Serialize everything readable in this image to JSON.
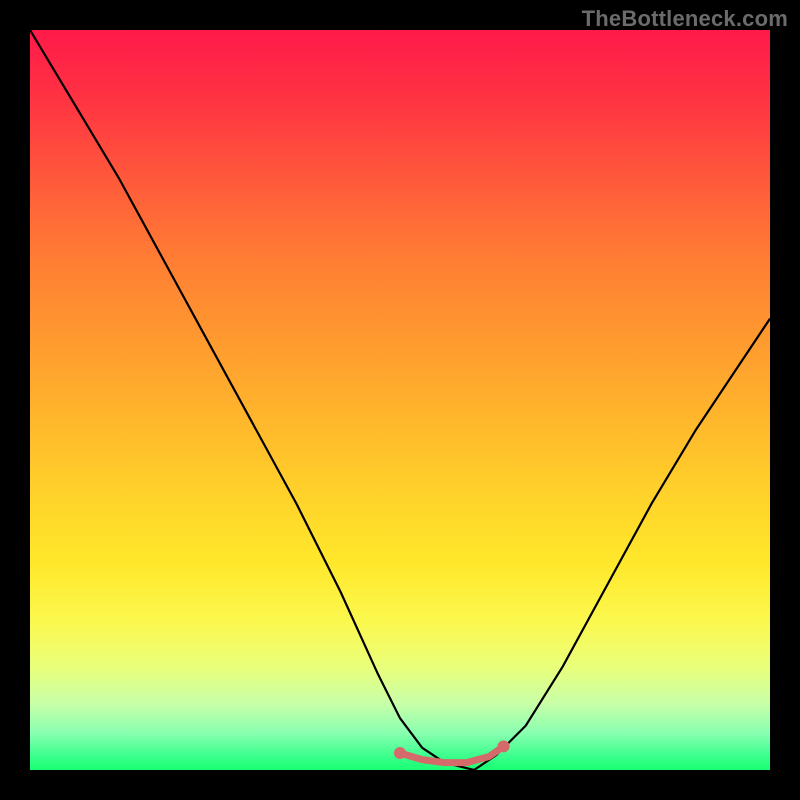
{
  "watermark": "TheBottleneck.com",
  "chart_data": {
    "type": "line",
    "title": "",
    "xlabel": "",
    "ylabel": "",
    "xlim": [
      0,
      100
    ],
    "ylim": [
      0,
      100
    ],
    "background_gradient": {
      "top": "#ff1a4a",
      "mid": "#ffe82b",
      "bottom": "#19ff72"
    },
    "series": [
      {
        "name": "bottleneck-curve",
        "color": "#000000",
        "stroke_width": 2.2,
        "x": [
          0,
          6,
          12,
          18,
          24,
          30,
          36,
          42,
          47,
          50,
          53,
          56,
          60,
          63,
          67,
          72,
          78,
          84,
          90,
          96,
          100
        ],
        "values": [
          100,
          90,
          80,
          69,
          58,
          47,
          36,
          24,
          13,
          7,
          3,
          1,
          0,
          2,
          6,
          14,
          25,
          36,
          46,
          55,
          61
        ]
      },
      {
        "name": "valley-band",
        "color": "#d46a6a",
        "stroke_width": 7,
        "x": [
          50,
          53,
          56,
          59,
          62,
          64
        ],
        "values": [
          2.3,
          1.4,
          1.0,
          1.0,
          1.8,
          3.2
        ]
      }
    ],
    "markers": [
      {
        "name": "valley-dot-left",
        "x": 50,
        "y": 2.3,
        "r": 6,
        "color": "#d46a6a"
      },
      {
        "name": "valley-dot-right",
        "x": 64,
        "y": 3.2,
        "r": 6,
        "color": "#d46a6a"
      }
    ]
  }
}
